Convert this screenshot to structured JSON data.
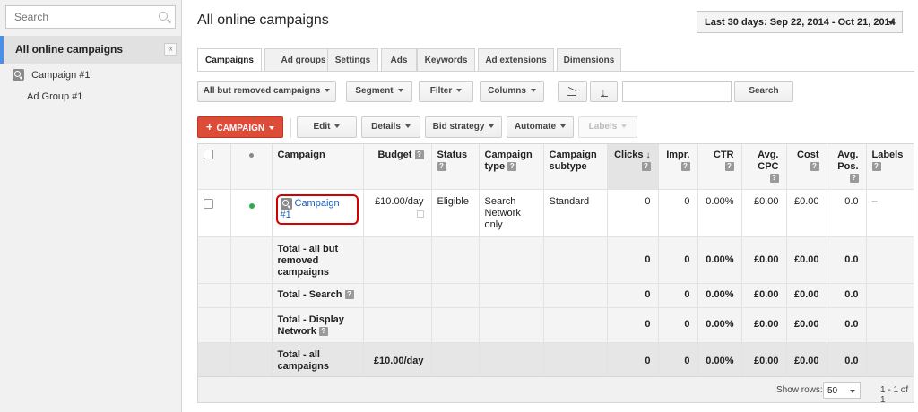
{
  "sidebar": {
    "search_placeholder": "Search",
    "all_campaigns": "All online campaigns",
    "collapse_glyph": "«",
    "campaign": "Campaign #1",
    "ad_group": "Ad Group #1"
  },
  "header": {
    "title": "All online campaigns",
    "date_range": "Last 30 days: Sep 22, 2014 - Oct 21, 2014"
  },
  "tabs": [
    "Campaigns",
    "Ad groups",
    "Settings",
    "Ads",
    "Keywords",
    "Ad extensions",
    "Dimensions"
  ],
  "toolbar1": {
    "filter_view": "All but removed campaigns",
    "segment": "Segment",
    "filter": "Filter",
    "columns": "Columns",
    "search_button": "Search"
  },
  "toolbar2": {
    "new_campaign": "CAMPAIGN",
    "plus": "+",
    "edit": "Edit",
    "details": "Details",
    "bid_strategy": "Bid strategy",
    "automate": "Automate",
    "labels": "Labels"
  },
  "table": {
    "headers": {
      "campaign": "Campaign",
      "budget": "Budget",
      "status": "Status",
      "campaign_type": "Campaign type",
      "campaign_subtype": "Campaign subtype",
      "clicks": "Clicks",
      "impr": "Impr.",
      "ctr": "CTR",
      "avg_cpc": "Avg. CPC",
      "cost": "Cost",
      "avg_pos": "Avg. Pos.",
      "labels": "Labels"
    },
    "help_glyph": "?",
    "sort_glyph": "↓",
    "row": {
      "campaign": "Campaign #1",
      "budget": "£10.00/day",
      "status": "Eligible",
      "campaign_type": "Search Network only",
      "campaign_subtype": "Standard",
      "clicks": "0",
      "impr": "0",
      "ctr": "0.00%",
      "avg_cpc": "£0.00",
      "cost": "£0.00",
      "avg_pos": "0.0",
      "labels": "–"
    },
    "totals": [
      {
        "label": "Total - all but removed campaigns",
        "budget": "",
        "clicks": "0",
        "impr": "0",
        "ctr": "0.00%",
        "avg_cpc": "£0.00",
        "cost": "£0.00",
        "avg_pos": "0.0",
        "help": false
      },
      {
        "label": "Total - Search",
        "budget": "",
        "clicks": "0",
        "impr": "0",
        "ctr": "0.00%",
        "avg_cpc": "£0.00",
        "cost": "£0.00",
        "avg_pos": "0.0",
        "help": true
      },
      {
        "label": "Total - Display Network",
        "budget": "",
        "clicks": "0",
        "impr": "0",
        "ctr": "0.00%",
        "avg_cpc": "£0.00",
        "cost": "£0.00",
        "avg_pos": "0.0",
        "help": true
      },
      {
        "label": "Total - all campaigns",
        "budget": "£10.00/day",
        "clicks": "0",
        "impr": "0",
        "ctr": "0.00%",
        "avg_cpc": "£0.00",
        "cost": "£0.00",
        "avg_pos": "0.0",
        "help": false
      }
    ]
  },
  "footer": {
    "show_rows": "Show rows:",
    "rows_value": "50",
    "pager": "1 - 1 of 1"
  }
}
